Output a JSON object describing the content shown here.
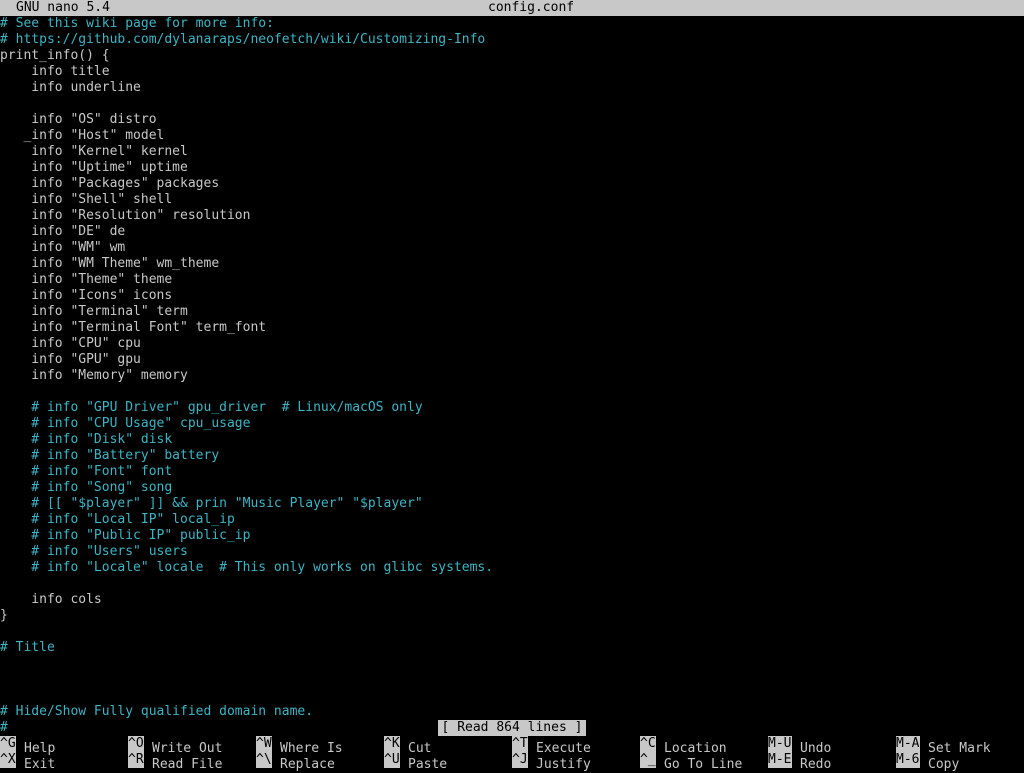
{
  "titlebar": {
    "app": "GNU nano 5.4",
    "file": "config.conf"
  },
  "editor": {
    "lines": [
      {
        "text": "# See this wiki page for more info:",
        "kind": "comment"
      },
      {
        "text": "# https://github.com/dylanaraps/neofetch/wiki/Customizing-Info",
        "kind": "comment"
      },
      {
        "text": "print_info() {",
        "kind": "code"
      },
      {
        "text": "    info title",
        "kind": "code"
      },
      {
        "text": "    info underline",
        "kind": "code"
      },
      {
        "text": "",
        "kind": "code"
      },
      {
        "text": "    info \"OS\" distro",
        "kind": "code"
      },
      {
        "text": "   _info \"Host\" model",
        "kind": "code"
      },
      {
        "text": "    info \"Kernel\" kernel",
        "kind": "code"
      },
      {
        "text": "    info \"Uptime\" uptime",
        "kind": "code"
      },
      {
        "text": "    info \"Packages\" packages",
        "kind": "code"
      },
      {
        "text": "    info \"Shell\" shell",
        "kind": "code"
      },
      {
        "text": "    info \"Resolution\" resolution",
        "kind": "code"
      },
      {
        "text": "    info \"DE\" de",
        "kind": "code"
      },
      {
        "text": "    info \"WM\" wm",
        "kind": "code"
      },
      {
        "text": "    info \"WM Theme\" wm_theme",
        "kind": "code"
      },
      {
        "text": "    info \"Theme\" theme",
        "kind": "code"
      },
      {
        "text": "    info \"Icons\" icons",
        "kind": "code"
      },
      {
        "text": "    info \"Terminal\" term",
        "kind": "code"
      },
      {
        "text": "    info \"Terminal Font\" term_font",
        "kind": "code"
      },
      {
        "text": "    info \"CPU\" cpu",
        "kind": "code"
      },
      {
        "text": "    info \"GPU\" gpu",
        "kind": "code"
      },
      {
        "text": "    info \"Memory\" memory",
        "kind": "code"
      },
      {
        "text": "",
        "kind": "code"
      },
      {
        "text": "    # info \"GPU Driver\" gpu_driver  # Linux/macOS only",
        "kind": "comment"
      },
      {
        "text": "    # info \"CPU Usage\" cpu_usage",
        "kind": "comment"
      },
      {
        "text": "    # info \"Disk\" disk",
        "kind": "comment"
      },
      {
        "text": "    # info \"Battery\" battery",
        "kind": "comment"
      },
      {
        "text": "    # info \"Font\" font",
        "kind": "comment"
      },
      {
        "text": "    # info \"Song\" song",
        "kind": "comment"
      },
      {
        "text": "    # [[ \"$player\" ]] && prin \"Music Player\" \"$player\"",
        "kind": "comment"
      },
      {
        "text": "    # info \"Local IP\" local_ip",
        "kind": "comment"
      },
      {
        "text": "    # info \"Public IP\" public_ip",
        "kind": "comment"
      },
      {
        "text": "    # info \"Users\" users",
        "kind": "comment"
      },
      {
        "text": "    # info \"Locale\" locale  # This only works on glibc systems.",
        "kind": "comment"
      },
      {
        "text": "",
        "kind": "code"
      },
      {
        "text": "    info cols",
        "kind": "code"
      },
      {
        "text": "}",
        "kind": "code"
      },
      {
        "text": "",
        "kind": "code"
      },
      {
        "text": "# Title",
        "kind": "comment"
      },
      {
        "text": "",
        "kind": "code"
      },
      {
        "text": "",
        "kind": "code"
      },
      {
        "text": "",
        "kind": "code"
      },
      {
        "text": "# Hide/Show Fully qualified domain name.",
        "kind": "comment"
      },
      {
        "text": "#",
        "kind": "comment"
      }
    ]
  },
  "status": {
    "message": "[ Read 864 lines ]"
  },
  "shortcuts": [
    {
      "key": "^G",
      "label": "Help",
      "col": 0,
      "row": 0
    },
    {
      "key": "^X",
      "label": "Exit",
      "col": 0,
      "row": 1
    },
    {
      "key": "^O",
      "label": "Write Out",
      "col": 1,
      "row": 0
    },
    {
      "key": "^R",
      "label": "Read File",
      "col": 1,
      "row": 1
    },
    {
      "key": "^W",
      "label": "Where Is",
      "col": 2,
      "row": 0
    },
    {
      "key": "^\\",
      "label": "Replace",
      "col": 2,
      "row": 1
    },
    {
      "key": "^K",
      "label": "Cut",
      "col": 3,
      "row": 0
    },
    {
      "key": "^U",
      "label": "Paste",
      "col": 3,
      "row": 1
    },
    {
      "key": "^T",
      "label": "Execute",
      "col": 4,
      "row": 0
    },
    {
      "key": "^J",
      "label": "Justify",
      "col": 4,
      "row": 1
    },
    {
      "key": "^C",
      "label": "Location",
      "col": 5,
      "row": 0
    },
    {
      "key": "^_",
      "label": "Go To Line",
      "col": 5,
      "row": 1
    },
    {
      "key": "M-U",
      "label": "Undo",
      "col": 6,
      "row": 0
    },
    {
      "key": "M-E",
      "label": "Redo",
      "col": 6,
      "row": 1
    },
    {
      "key": "M-A",
      "label": "Set Mark",
      "col": 7,
      "row": 0
    },
    {
      "key": "M-6",
      "label": "Copy",
      "col": 7,
      "row": 1
    }
  ],
  "colors": {
    "comment": "#3bb5c5",
    "text": "#c8c8c8",
    "bar": "#c8c8c8",
    "background": "#000000"
  }
}
